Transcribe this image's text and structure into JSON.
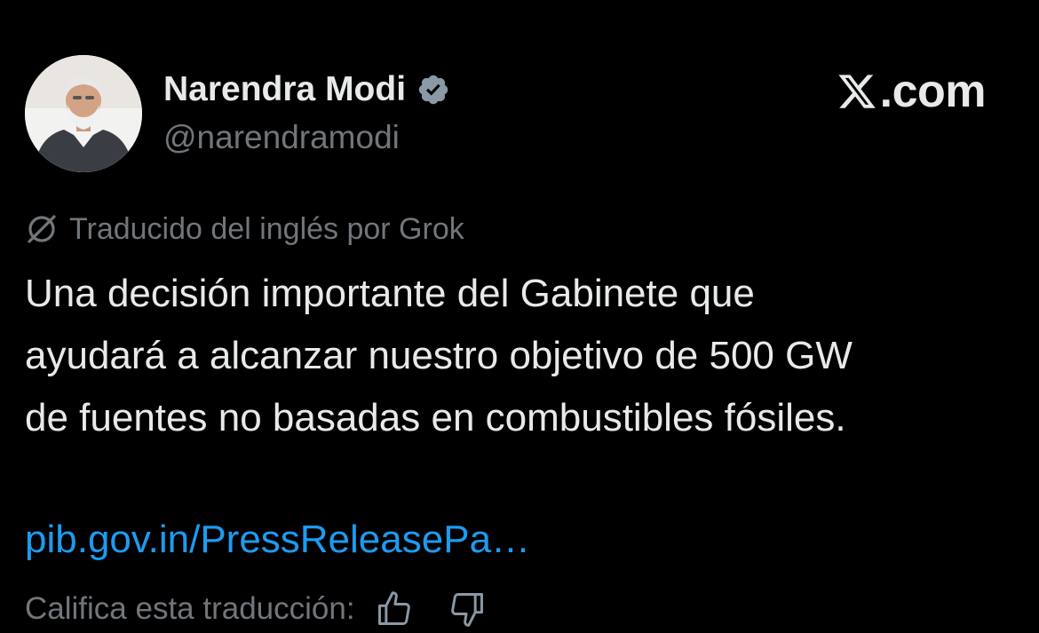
{
  "author": {
    "display_name": "Narendra Modi",
    "handle": "@narendramodi",
    "verified": true,
    "verified_color": "#8b98a5"
  },
  "brand": {
    "text": ".com",
    "icon": "x-logo-icon"
  },
  "translation": {
    "icon": "grok-icon",
    "label": "Traducido del inglés por Grok"
  },
  "post": {
    "text": "Una decisión importante del Gabinete que\nayudará a alcanzar nuestro objetivo de 500 GW\nde fuentes no basadas en combustibles fósiles.",
    "link_text": "pib.gov.in/PressReleasePa…"
  },
  "rating": {
    "label": "Califica esta traducción:",
    "thumbs_up_icon": "thumbs-up-icon",
    "thumbs_down_icon": "thumbs-down-icon"
  },
  "colors": {
    "background": "#000000",
    "primary_text": "#e7e9ea",
    "secondary_text": "#71767b",
    "link": "#1d9bf0"
  }
}
